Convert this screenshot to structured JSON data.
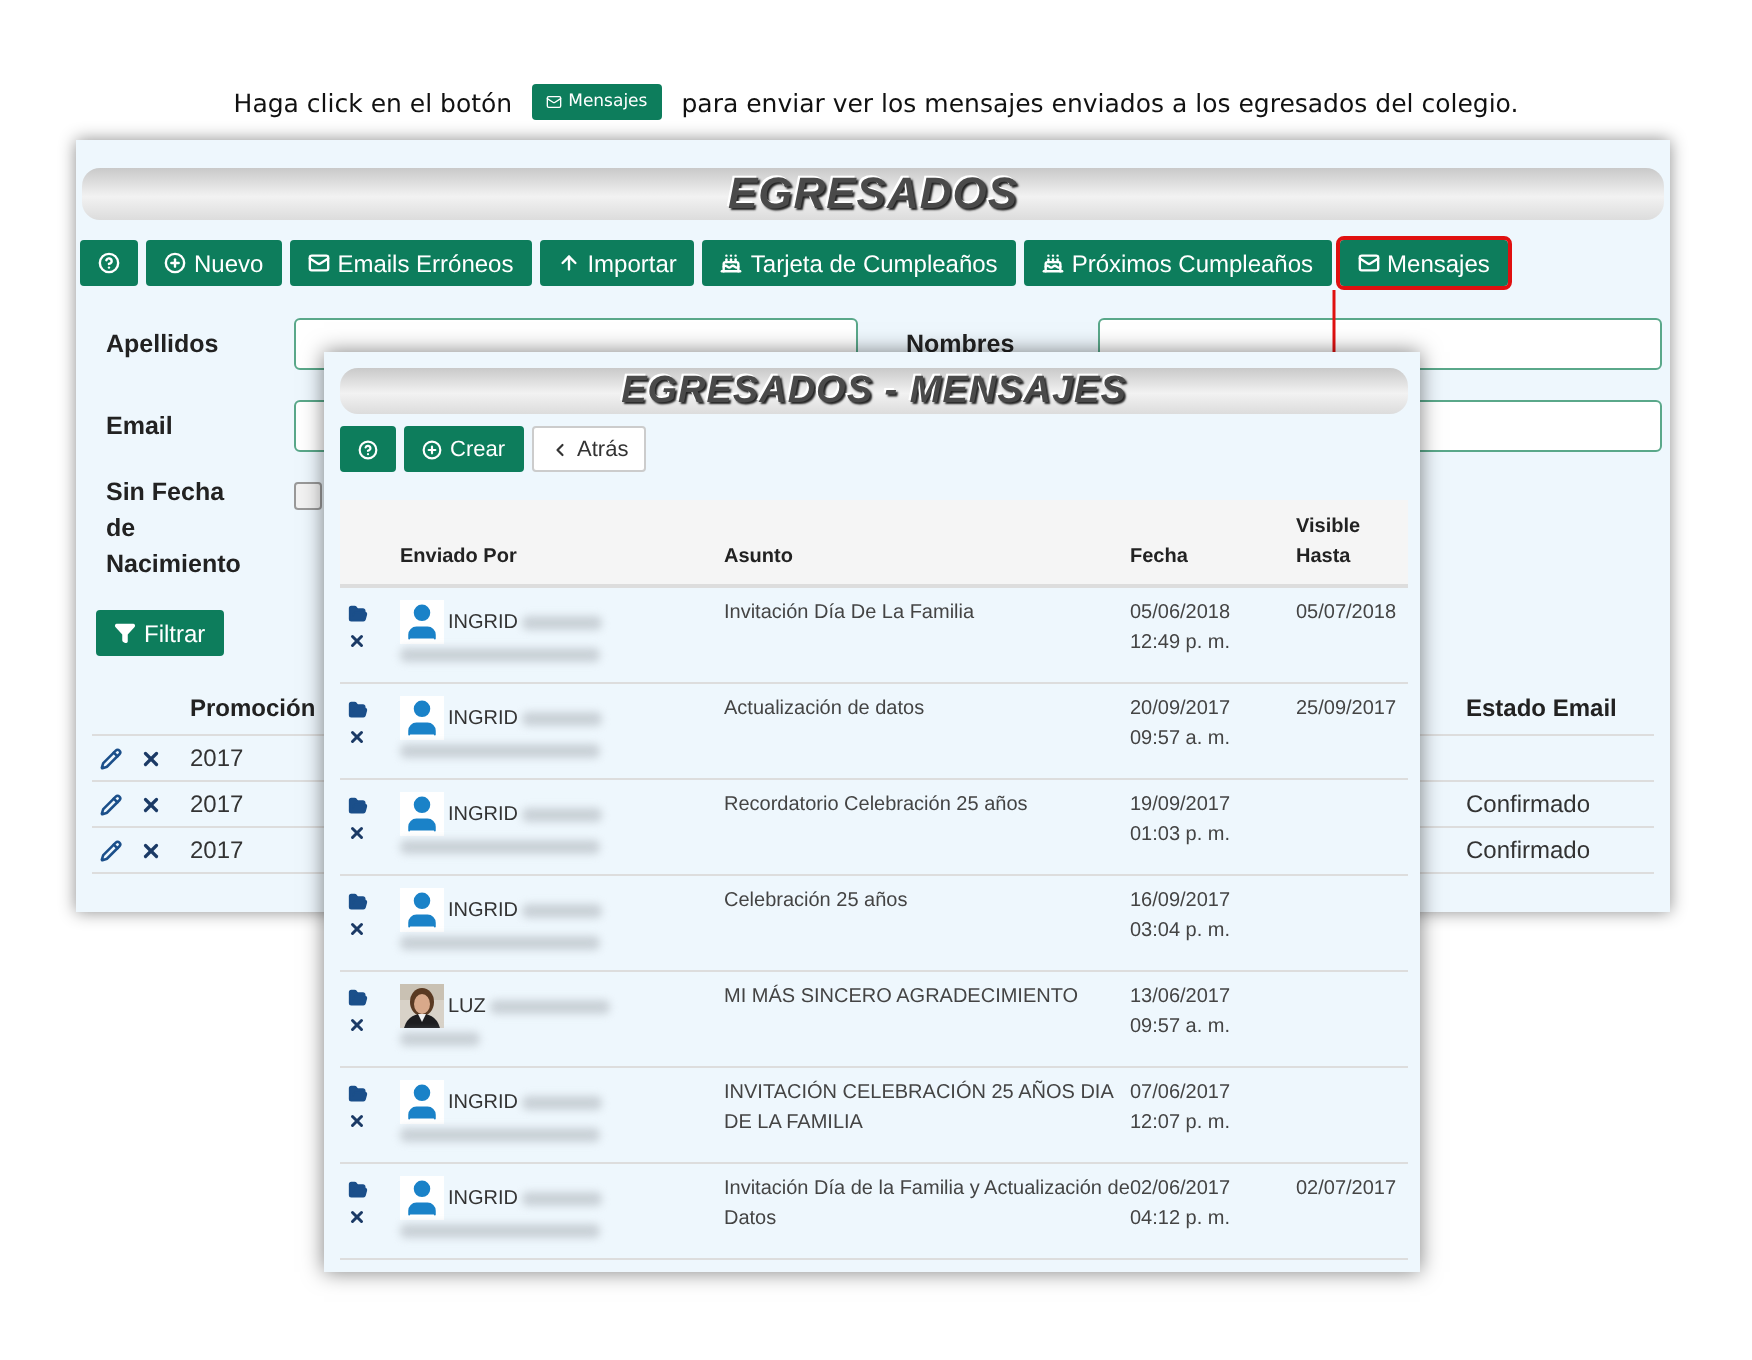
{
  "caption": {
    "before": "Haga click en el botón",
    "button": "Mensajes",
    "after": "para enviar ver los mensajes enviados a los egresados del colegio."
  },
  "main": {
    "title": "EGRESADOS",
    "toolbar": [
      {
        "kind": "help"
      },
      {
        "kind": "new",
        "label": "Nuevo"
      },
      {
        "kind": "mail",
        "label": "Emails Erróneos"
      },
      {
        "kind": "upload",
        "label": "Importar"
      },
      {
        "kind": "cake",
        "label": "Tarjeta de Cumpleaños"
      },
      {
        "kind": "cake",
        "label": "Próximos Cumpleaños"
      },
      {
        "kind": "mail",
        "label": "Mensajes",
        "highlighted": true
      }
    ],
    "form_rows": [
      [
        {
          "label": "Apellidos"
        },
        {
          "label": "Nombres"
        }
      ],
      [
        {
          "label": "Email"
        }
      ]
    ],
    "checkbox": {
      "label": "Sin Fecha de Nacimiento",
      "checked": false
    },
    "filter_button": "Filtrar",
    "table": {
      "columns": [
        "Promoción",
        "Estado Email"
      ],
      "rows": [
        {
          "promocion": "2017"
        },
        {
          "promocion": "2017",
          "estado": "Confirmado"
        },
        {
          "promocion": "2017",
          "estado": "Confirmado"
        }
      ]
    }
  },
  "modal": {
    "title": "EGRESADOS - MENSAJES",
    "toolbar": [
      {
        "kind": "help"
      },
      {
        "kind": "create",
        "label": "Crear"
      },
      {
        "kind": "back",
        "label": "Atrás"
      }
    ],
    "columns": [
      "Enviado Por",
      "Asunto",
      "Fecha",
      "Visible Hasta"
    ],
    "rows": [
      {
        "sender": "INGRID",
        "kind": "default",
        "subject": "Invitación Día De La Familia",
        "date": "05/06/2018",
        "time": "12:49 p. m.",
        "visible_until": "05/07/2018"
      },
      {
        "sender": "INGRID",
        "kind": "default",
        "subject": "Actualización de datos",
        "date": "20/09/2017",
        "time": "09:57 a. m.",
        "visible_until": "25/09/2017"
      },
      {
        "sender": "INGRID",
        "kind": "default",
        "subject": "Recordatorio Celebración 25 años",
        "date": "19/09/2017",
        "time": "01:03 p. m."
      },
      {
        "sender": "INGRID",
        "kind": "default",
        "subject": "Celebración 25 años",
        "date": "16/09/2017",
        "time": "03:04 p. m."
      },
      {
        "sender": "LUZ",
        "subject": "MI MÁS SINCERO AGRADECIMIENTO",
        "date": "13/06/2017",
        "time": "09:57 a. m."
      },
      {
        "sender": "INGRID",
        "kind": "default",
        "subject": "INVITACIÓN CELEBRACIÓN 25 AÑOS DIA DE LA FAMILIA",
        "date": "07/06/2017",
        "time": "12:07 p. m."
      },
      {
        "sender": "INGRID",
        "kind": "default",
        "subject": "Invitación Día de la Familia y Actualización de Datos",
        "date": "02/06/2017",
        "time": "04:12 p. m.",
        "visible_until": "02/07/2017"
      }
    ]
  }
}
